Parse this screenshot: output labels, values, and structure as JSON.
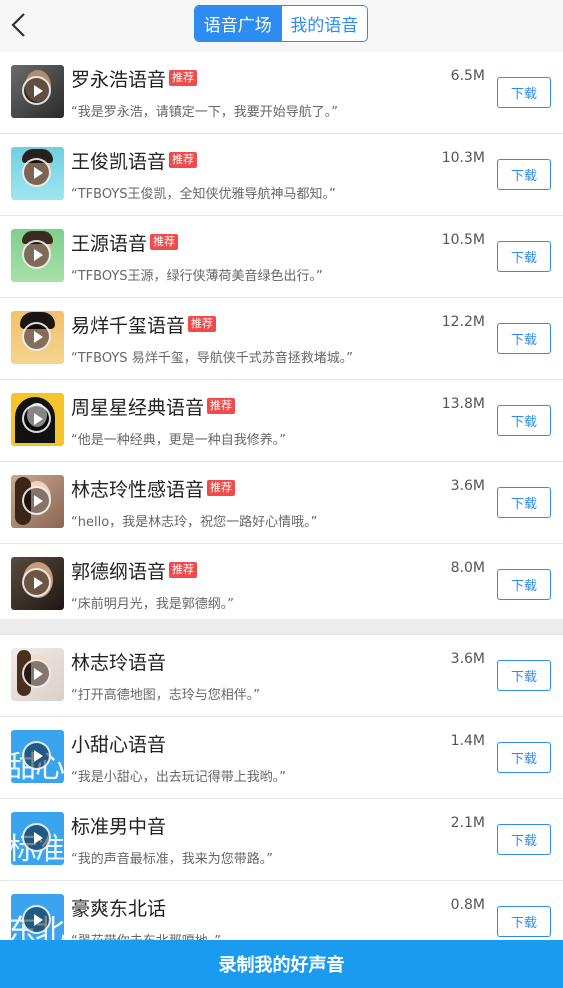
{
  "header": {
    "tabs": [
      {
        "label": "语音广场",
        "active": true
      },
      {
        "label": "我的语音",
        "active": false
      }
    ]
  },
  "colors": {
    "accent": "#2d8cf0",
    "badge": "#ef4b4b",
    "footer": "#1a9bf0"
  },
  "recommended": [
    {
      "title": "罗永浩语音",
      "badge": "推荐",
      "desc": "“我是罗永浩，请镇定一下，我要开始导航了。”",
      "size": "6.5M",
      "button": "下载"
    },
    {
      "title": "王俊凯语音",
      "badge": "推荐",
      "desc": "“TFBOYS王俊凯，全知侠优雅导航神马都知。”",
      "size": "10.3M",
      "button": "下载"
    },
    {
      "title": "王源语音",
      "badge": "推荐",
      "desc": "“TFBOYS王源，绿行侠薄荷美音绿色出行。”",
      "size": "10.5M",
      "button": "下载"
    },
    {
      "title": "易烊千玺语音",
      "badge": "推荐",
      "desc": "“TFBOYS 易烊千玺，导航侠千式苏音拯救堵城。”",
      "size": "12.2M",
      "button": "下载"
    },
    {
      "title": "周星星经典语音",
      "badge": "推荐",
      "desc": "“他是一种经典，更是一种自我修养。”",
      "size": "13.8M",
      "button": "下载"
    },
    {
      "title": "林志玲性感语音",
      "badge": "推荐",
      "desc": "“hello，我是林志玲，祝您一路好心情哦。”",
      "size": "3.6M",
      "button": "下载"
    },
    {
      "title": "郭德纲语音",
      "badge": "推荐",
      "desc": "“床前明月光，我是郭德纲。”",
      "size": "8.0M",
      "button": "下载"
    }
  ],
  "others": [
    {
      "title": "林志玲语音",
      "desc": "“打开高德地图，志玲与您相伴。”",
      "size": "3.6M",
      "button": "下载",
      "tile": ""
    },
    {
      "title": "小甜心语音",
      "desc": "“我是小甜心，出去玩记得带上我哟。”",
      "size": "1.4M",
      "button": "下载",
      "tile": "甜心"
    },
    {
      "title": "标准男中音",
      "desc": "“我的声音最标准，我来为您带路。”",
      "size": "2.1M",
      "button": "下载",
      "tile": "标准"
    },
    {
      "title": "豪爽东北话",
      "desc": "“翠花带你去东北那嘎地。”",
      "size": "0.8M",
      "button": "下载",
      "tile": "东北"
    }
  ],
  "footer": {
    "label": "录制我的好声音"
  }
}
